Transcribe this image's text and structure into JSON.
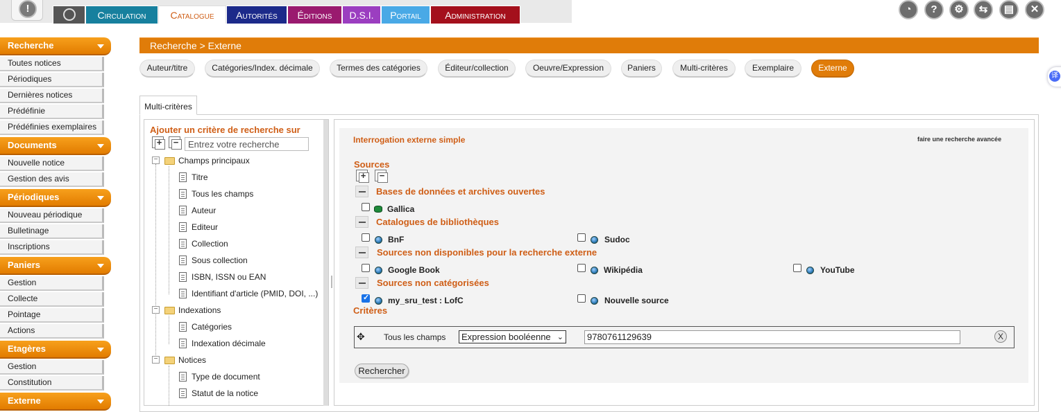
{
  "topnav": {
    "items": [
      {
        "label": "Circulation",
        "bg": "#17809e"
      },
      {
        "label": "Catalogue",
        "bg": "#ffffff",
        "active": true
      },
      {
        "label": "Autorités",
        "bg": "#1c2a8a"
      },
      {
        "label": "Éditions",
        "bg": "#9a1a6f"
      },
      {
        "label": "D.S.I.",
        "bg": "#9b3ec0"
      },
      {
        "label": "Portail",
        "bg": "#49a9e6"
      },
      {
        "label": "Administration",
        "bg": "#a4101c"
      }
    ],
    "right_icons": [
      "clock-icon",
      "help-icon",
      "settings-icon",
      "users-icon",
      "save-icon",
      "close-icon"
    ]
  },
  "left_menu": [
    {
      "title": "Recherche",
      "items": [
        "Toutes notices",
        "Périodiques",
        "Dernières notices",
        "Prédéfinie",
        "Prédéfinies exemplaires"
      ]
    },
    {
      "title": "Documents",
      "items": [
        "Nouvelle notice",
        "Gestion des avis"
      ]
    },
    {
      "title": "Périodiques",
      "items": [
        "Nouveau périodique",
        "Bulletinage",
        "Inscriptions"
      ]
    },
    {
      "title": "Paniers",
      "items": [
        "Gestion",
        "Collecte",
        "Pointage",
        "Actions"
      ]
    },
    {
      "title": "Etagères",
      "items": [
        "Gestion",
        "Constitution"
      ]
    },
    {
      "title": "Externe",
      "items": []
    }
  ],
  "breadcrumb": "Recherche > Externe",
  "subtabs": [
    "Auteur/titre",
    "Catégories/Index. décimale",
    "Termes des catégories",
    "Éditeur/collection",
    "Oeuvre/Expression",
    "Paniers",
    "Multi-critères",
    "Exemplaire",
    "Externe"
  ],
  "active_subtab": "Externe",
  "tab_label": "Multi-critères",
  "tree": {
    "title": "Ajouter un critère de recherche sur",
    "search_placeholder": "Entrez votre recherche",
    "groups": [
      {
        "label": "Champs principaux",
        "children": [
          "Titre",
          "Tous les champs",
          "Auteur",
          "Editeur",
          "Collection",
          "Sous collection",
          "ISBN, ISSN ou EAN",
          "Identifiant d'article (PMID, DOI, ...)"
        ]
      },
      {
        "label": "Indexations",
        "children": [
          "Catégories",
          "Indexation décimale"
        ]
      },
      {
        "label": "Notices",
        "children": [
          "Type de document",
          "Statut de la notice"
        ]
      }
    ]
  },
  "external": {
    "heading": "Interrogation externe simple",
    "advanced_link": "faire une recherche avancée",
    "sources_label": "Sources",
    "categories": [
      {
        "label": "Bases de données et archives ouvertes",
        "sources": [
          {
            "name": "Gallica",
            "checked": false,
            "icon": "database-icon"
          }
        ]
      },
      {
        "label": "Catalogues de bibliothèques",
        "sources": [
          {
            "name": "BnF",
            "checked": false,
            "icon": "globe-icon"
          },
          {
            "name": "Sudoc",
            "checked": false,
            "icon": "globe-icon"
          }
        ]
      },
      {
        "label": "Sources non disponibles pour la recherche externe",
        "sources": [
          {
            "name": "Google Book",
            "checked": false,
            "icon": "globe-icon"
          },
          {
            "name": "Wikipédia",
            "checked": false,
            "icon": "globe-icon"
          },
          {
            "name": "YouTube",
            "checked": false,
            "icon": "globe-icon"
          }
        ]
      },
      {
        "label": "Sources non catégorisées",
        "sources": [
          {
            "name": "my_sru_test : LofC",
            "checked": true,
            "icon": "globe-icon"
          },
          {
            "name": "Nouvelle source",
            "checked": false,
            "icon": "globe-icon"
          }
        ]
      }
    ],
    "criteria_label": "Critères",
    "criterion": {
      "field": "Tous les champs",
      "operator": "Expression booléenne",
      "value": "9780761129639",
      "delete_label": "X"
    },
    "search_button": "Rechercher"
  }
}
